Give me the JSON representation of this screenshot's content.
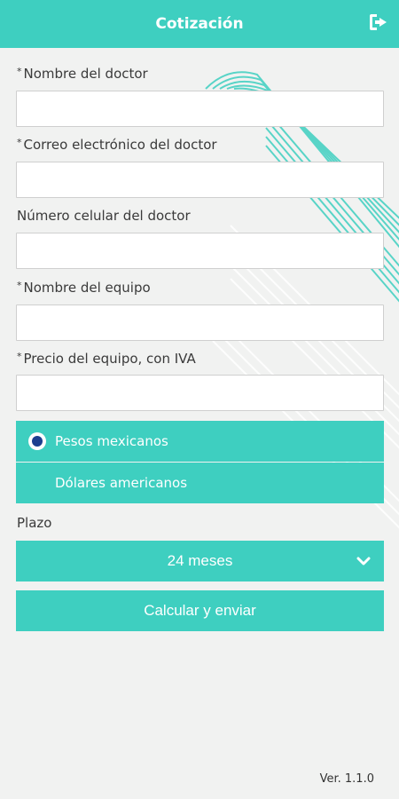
{
  "header": {
    "title": "Cotización",
    "logout_icon": "sign-out-icon"
  },
  "form": {
    "fields": [
      {
        "label": "Nombre del doctor",
        "required": true,
        "value": ""
      },
      {
        "label": "Correo electrónico del doctor",
        "required": true,
        "value": ""
      },
      {
        "label": "Número celular del doctor",
        "required": false,
        "value": ""
      },
      {
        "label": "Nombre del equipo",
        "required": true,
        "value": ""
      },
      {
        "label": "Precio del equipo, con IVA",
        "required": true,
        "value": ""
      }
    ],
    "required_marker": "*",
    "currency": {
      "options": [
        "Pesos mexicanos",
        "Dólares americanos"
      ],
      "selected": "Pesos mexicanos"
    },
    "plazo": {
      "label": "Plazo",
      "selected": "24 meses"
    },
    "submit_label": "Calcular y enviar"
  },
  "footer": {
    "version": "Ver. 1.1.0"
  },
  "colors": {
    "accent": "#3ecfc0",
    "radio_selected": "#1c3f8f",
    "background": "#f1f2f1"
  }
}
